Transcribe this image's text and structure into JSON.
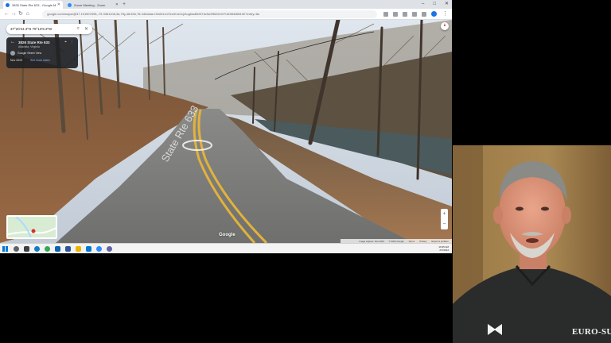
{
  "browser": {
    "tabs": [
      {
        "label": "3826 State Rte 633 - Google M",
        "favicon_color": "#1a73e8",
        "active": true
      },
      {
        "label": "Zoom Meeting - Zoom",
        "favicon_color": "#2d8cff",
        "active": false
      }
    ],
    "new_tab": "+",
    "window_controls": [
      "–",
      "□",
      "✕"
    ],
    "url": "google.com/maps/@37.101907695,-79.3361108,3a,75y,48.83h,78.44t/data=!3m6!1e1!3m4!1sOqVlug6ssBkHi7dv9u9f60!2e0!7i16384!8i8192?entry=ttu",
    "nav": {
      "back": "←",
      "forward": "→",
      "reload": "↻",
      "home": "⌂"
    }
  },
  "maps": {
    "search_text": "37°20'24.3\"N 79°13'9.3\"W",
    "search_icon": "search-icon",
    "close_icon": "close-icon",
    "place_title": "3826 State Rte 633",
    "place_subtitle": "Altavista, Virginia",
    "provider": "Google Street View",
    "date": "Nov 2023",
    "see_more_dates": "See more dates",
    "road_sign_text": "State Rte 633",
    "google_logo": "Google",
    "footer": [
      "Image capture: Nov 2023",
      "© 2024 Google",
      "Terms",
      "Privacy",
      "Report a problem"
    ],
    "zoom_in": "+",
    "zoom_out": "−"
  },
  "taskbar": {
    "apps": [
      {
        "name": "search-app",
        "color": "#5f6368"
      },
      {
        "name": "task-view-app",
        "color": "#3c4043"
      },
      {
        "name": "edge-app",
        "color": "#0f7ec7"
      },
      {
        "name": "chrome-app",
        "color": "#34a853"
      },
      {
        "name": "outlook-app",
        "color": "#0a64ad"
      },
      {
        "name": "word-app",
        "color": "#2b579a"
      },
      {
        "name": "explorer-app",
        "color": "#f0b400"
      },
      {
        "name": "mail-app",
        "color": "#0078d4"
      },
      {
        "name": "zoom-app",
        "color": "#2d8cff"
      },
      {
        "name": "teams-app",
        "color": "#6264a7"
      }
    ],
    "time": "10:35 AM",
    "date": "2/7/2024"
  },
  "webcam": {
    "logo_text": "EURO-SUIT"
  }
}
